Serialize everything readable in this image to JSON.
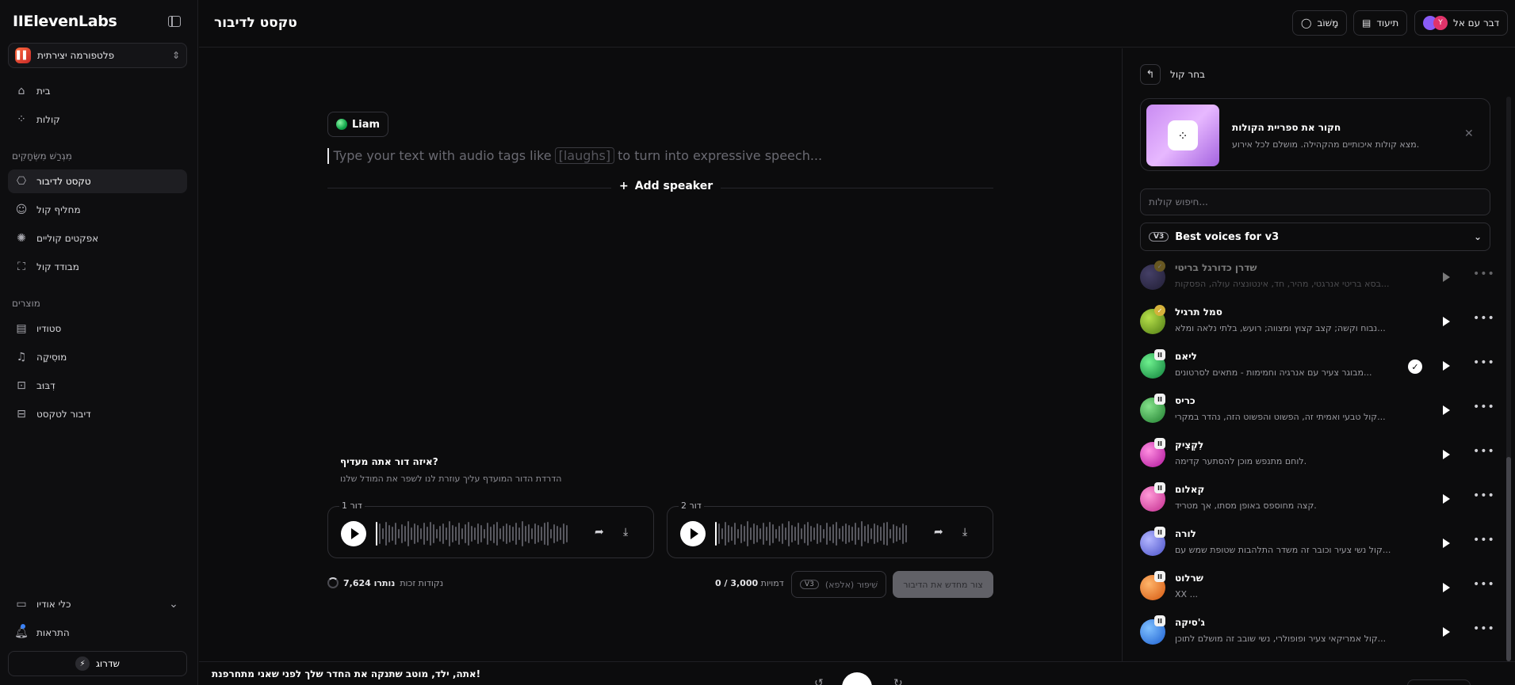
{
  "sidebar": {
    "brand": "IIElevenLabs",
    "workspace": "פלטפורמה יצירתית",
    "nav_top": [
      {
        "label": "בית",
        "icon": "home-icon"
      },
      {
        "label": "קולות",
        "icon": "voices-icon"
      }
    ],
    "section_playground": "מִגְרַשׁ מִשְׂחָקִים",
    "nav_playground": [
      {
        "label": "טקסט לדיבור",
        "icon": "tts-icon"
      },
      {
        "label": "מחליף קול",
        "icon": "voice-changer-icon"
      },
      {
        "label": "אפקטים קוליים",
        "icon": "sound-effects-icon"
      },
      {
        "label": "מבודד קול",
        "icon": "voice-isolator-icon"
      }
    ],
    "section_products": "מוצרים",
    "nav_products": [
      {
        "label": "סטודיו",
        "icon": "studio-icon"
      },
      {
        "label": "מוּסִיקָה",
        "icon": "music-icon"
      },
      {
        "label": "דִבּוּב",
        "icon": "dubbing-icon"
      },
      {
        "label": "דיבור לטקסט",
        "icon": "stt-icon"
      }
    ],
    "audio_tools": "כלי אודיו",
    "notifications": "התראות",
    "upgrade": "שדרוג"
  },
  "topbar": {
    "title": "טקסט לדיבור",
    "feedback": "מָשׁוֹב",
    "docs": "תיעוד",
    "talk": "דבר עם אל",
    "avatar_letter": "Y"
  },
  "editor": {
    "speaker": "Liam",
    "placeholder_before": "Type your text with audio tags like",
    "placeholder_tag": "[laughs]",
    "placeholder_after": "to turn into expressive speech...",
    "add_speaker": "Add speaker",
    "preference_question": "איזה דור אתה מעדיף?",
    "preference_sub": "הדרדת הדור המועדף עליך עוזרת לנו לשפר את המודל שלנו",
    "gen1_label": "דור 1",
    "gen2_label": "דור 2",
    "credits_label": "נקודות זכות",
    "credits_value": "7,624 נותרו",
    "chars_label": "דמויות",
    "chars_value": "0 / 3,000",
    "enhance_label": "שִׁיפּוּר (אלפא)",
    "v3": "V3",
    "regenerate": "צור מחדש את הדיבור"
  },
  "player": {
    "now_playing": "אתה, ילד, מוטב שתנקה את החדר שלך לפני שאני מתחרפנת!"
  },
  "panel": {
    "title": "בחר קול",
    "promo_title": "חקור את ספריית הקולות",
    "promo_sub": "מצא קולות איכותיים מהקהילה. מושלם לכל אירוע.",
    "search_placeholder": "חיפוש קולות...",
    "filter_tag": "V3",
    "filter_label": "Best voices for v3",
    "voices": [
      {
        "name": "שדרן כדורגל בריטי",
        "desc": "בסא בריטי אנרגטי, מהיר, חד, אינטונציה עולה, הפסקות...",
        "badge": "✓",
        "badge_style": "gold",
        "colors": [
          "#8a7fd3",
          "#3b3466"
        ],
        "dim": true,
        "selected": false
      },
      {
        "name": "סמל תרגיל",
        "desc": "נבוח וקשה; קצב קצוץ ומצווה; רועש, בלתי נלאה ומלא...",
        "badge": "✓",
        "badge_style": "gold",
        "colors": [
          "#b6e04a",
          "#4e7a12"
        ],
        "dim": false,
        "selected": false
      },
      {
        "name": "ליאם",
        "desc": "מבוגר צעיר עם אנרגיה וחמימות - מתאים לסרטונים...",
        "badge": "II",
        "badge_style": "plain",
        "colors": [
          "#6ef08e",
          "#0e7f3a"
        ],
        "dim": false,
        "selected": true
      },
      {
        "name": "כריס",
        "desc": "קול טבעי ואמיתי זה, הפשוט והפשוט הזה, נהדר במקרי...",
        "badge": "II",
        "badge_style": "plain",
        "colors": [
          "#84e28a",
          "#1f7d2e"
        ],
        "dim": false,
        "selected": false
      },
      {
        "name": "לִקְצִיק",
        "desc": "לוחם מתנפש מוכן להסתער קדימה.",
        "badge": "II",
        "badge_style": "plain",
        "colors": [
          "#ff8fe1",
          "#b0139a"
        ],
        "dim": false,
        "selected": false
      },
      {
        "name": "קאלום",
        "desc": "קצה מחוספס באופן מסתו, אך מטריד.",
        "badge": "II",
        "badge_style": "plain",
        "colors": [
          "#ff9ad8",
          "#c22a8d"
        ],
        "dim": false,
        "selected": false
      },
      {
        "name": "לורה",
        "desc": "קול נשי צעיר וכובר זה משדר התלהבות שטופת שמש עם...",
        "badge": "II",
        "badge_style": "plain",
        "colors": [
          "#b3b6ff",
          "#4a51c9"
        ],
        "dim": false,
        "selected": false
      },
      {
        "name": "שרלוט",
        "desc": "XX ...",
        "badge": "II",
        "badge_style": "plain",
        "colors": [
          "#ffb56a",
          "#d4570f"
        ],
        "dim": false,
        "selected": false
      },
      {
        "name": "ג'סיקה",
        "desc": "קול אמריקאי צעיר ופופולרי, נשי שובב זה מושלם לתוכן...",
        "badge": "II",
        "badge_style": "plain",
        "colors": [
          "#7fc0ff",
          "#1c5fd0"
        ],
        "dim": false,
        "selected": false
      }
    ]
  },
  "colors": {
    "background": "#0c0c0d",
    "accent_play": "#ffffff",
    "regenerate_disabled": "#616167"
  }
}
